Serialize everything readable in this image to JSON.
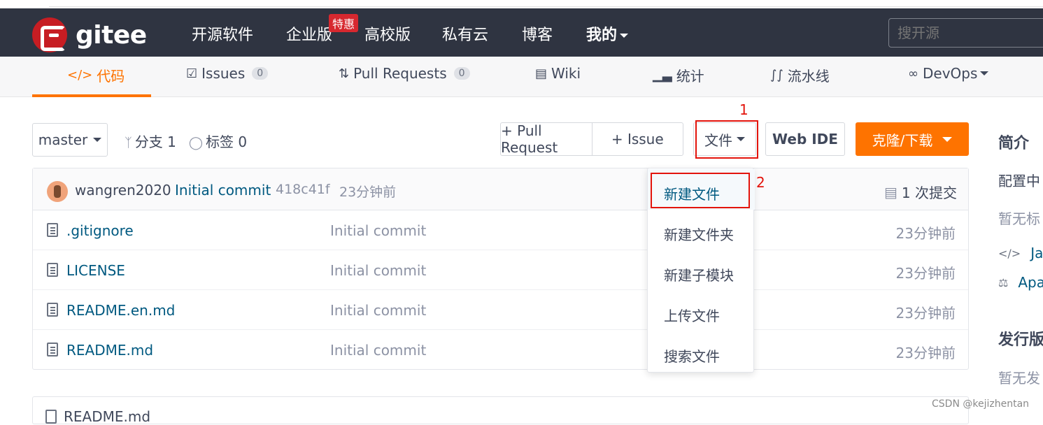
{
  "topnav": {
    "logo_text": "gitee",
    "links": [
      "开源软件",
      "企业版",
      "高校版",
      "私有云",
      "博客",
      "我的"
    ],
    "promo_badge": "特惠",
    "search_placeholder": "搜开源"
  },
  "tabs": {
    "code": "代码",
    "issues": "Issues",
    "issues_count": "0",
    "pulls": "Pull Requests",
    "pulls_count": "0",
    "wiki": "Wiki",
    "stats": "统计",
    "pipeline": "流水线",
    "devops": "DevOps"
  },
  "toolbar": {
    "branch": "master",
    "branches": "分支 1",
    "tags": "标签 0",
    "pull_request": "+ Pull Request",
    "issue": "+ Issue",
    "file": "文件",
    "web_ide": "Web IDE",
    "clone": "克隆/下载"
  },
  "annotations": {
    "step1": "1",
    "step2": "2"
  },
  "last_commit": {
    "author": "wangren2020",
    "message": "Initial commit",
    "hash": "418c41f",
    "time": "23分钟前",
    "total": "1 次提交"
  },
  "files": [
    {
      "name": ".gitignore",
      "message": "Initial commit",
      "time": "23分钟前"
    },
    {
      "name": "LICENSE",
      "message": "Initial commit",
      "time": "23分钟前"
    },
    {
      "name": "README.en.md",
      "message": "Initial commit",
      "time": "23分钟前"
    },
    {
      "name": "README.md",
      "message": "Initial commit",
      "time": "23分钟前"
    }
  ],
  "file_menu": [
    "新建文件",
    "新建文件夹",
    "新建子模块",
    "上传文件",
    "搜索文件"
  ],
  "readme_label": "README.md",
  "sidebar": {
    "intro_title": "简介",
    "intro_text": "配置中",
    "no_tags": "暂无标",
    "language": "Jav",
    "license": "Apa",
    "releases_title": "发行版",
    "no_releases": "暂无发"
  },
  "watermark": "CSDN @kejizhentan",
  "colors": {
    "brand": "#c71d23",
    "accent": "#fe7300",
    "nav_bg": "#2f3441",
    "link": "#005980",
    "annotation": "#e3140c"
  }
}
